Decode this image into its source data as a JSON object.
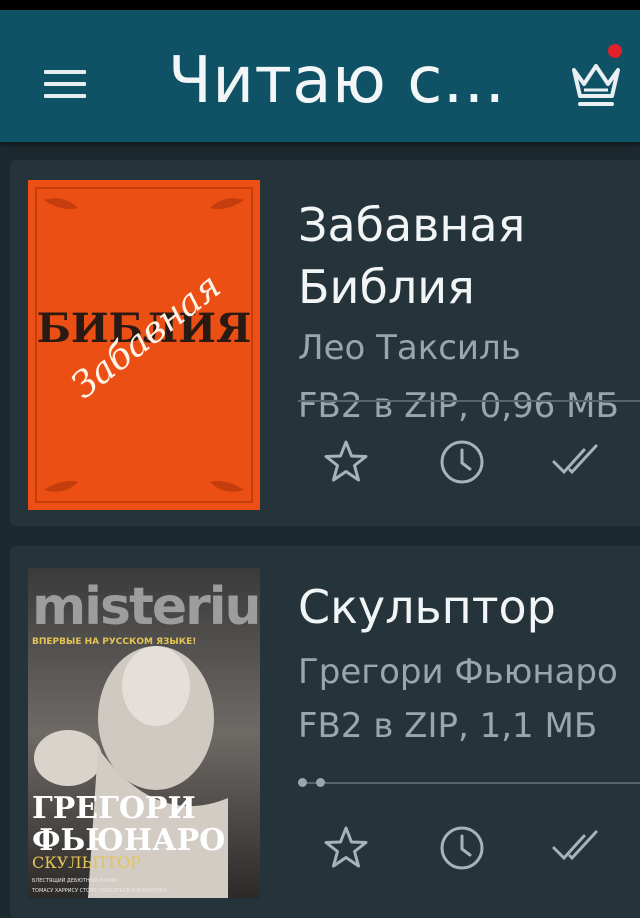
{
  "app": {
    "title": "Читаю с..."
  },
  "colors": {
    "appbar": "#0f5266",
    "background": "#1c2a30",
    "card": "#25343b",
    "badge": "#e0202a"
  },
  "books": [
    {
      "title_line1": "Забавная",
      "title_line2": "Библия",
      "author": "Лео Таксиль",
      "format": "FB2 в ZIP, 0,96 МБ",
      "cover": {
        "text_main": "БИБЛИЯ",
        "text_script": "Забавная",
        "color": "#ec4f14"
      }
    },
    {
      "title_line1": "Скульптор",
      "author": "Грегори Фьюнаро",
      "format": "FB2 в ZIP, 1,1 МБ",
      "cover": {
        "series": "misterium",
        "banner": "ВПЕРВЫЕ НА РУССКОМ ЯЗЫКЕ!",
        "author_line1": "ГРЕГОРИ",
        "author_line2": "ФЬЮНАРО",
        "title": "СКУЛЬПТОР",
        "tagline1": "БЛЕСТЯЩИЙ ДЕБЮТНЫЙ РОМАН.",
        "tagline2": "ТОМАСУ ХАРРИСУ СТОИТ ОПАСАТЬСЯ КОНКУРЕНТА!"
      }
    }
  ],
  "icons": [
    "menu-icon",
    "crown-icon",
    "star-icon",
    "clock-icon",
    "double-check-icon"
  ]
}
